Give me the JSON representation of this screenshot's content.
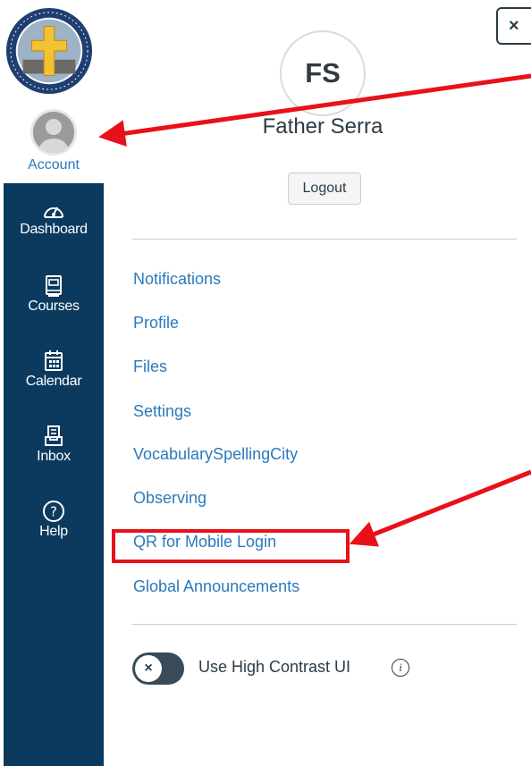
{
  "nav": {
    "account_label": "Account",
    "items": [
      {
        "label": "Dashboard",
        "icon": "dashboard-icon"
      },
      {
        "label": "Courses",
        "icon": "courses-icon"
      },
      {
        "label": "Calendar",
        "icon": "calendar-icon"
      },
      {
        "label": "Inbox",
        "icon": "inbox-icon"
      },
      {
        "label": "Help",
        "icon": "help-icon"
      }
    ]
  },
  "tray": {
    "close_label": "×",
    "avatar_initials": "FS",
    "user_name": "Father Serra",
    "logout_label": "Logout",
    "links": [
      "Notifications",
      "Profile",
      "Files",
      "Settings",
      "VocabularySpellingCity",
      "Observing",
      "QR for Mobile Login",
      "Global Announcements"
    ],
    "high_contrast_label": "Use High Contrast UI",
    "toggle_knob": "×",
    "info_glyph": "i"
  },
  "colors": {
    "nav_bg": "#0b3a5e",
    "link": "#2b7abc",
    "text": "#2d3b45",
    "annotation": "#e8111a"
  }
}
